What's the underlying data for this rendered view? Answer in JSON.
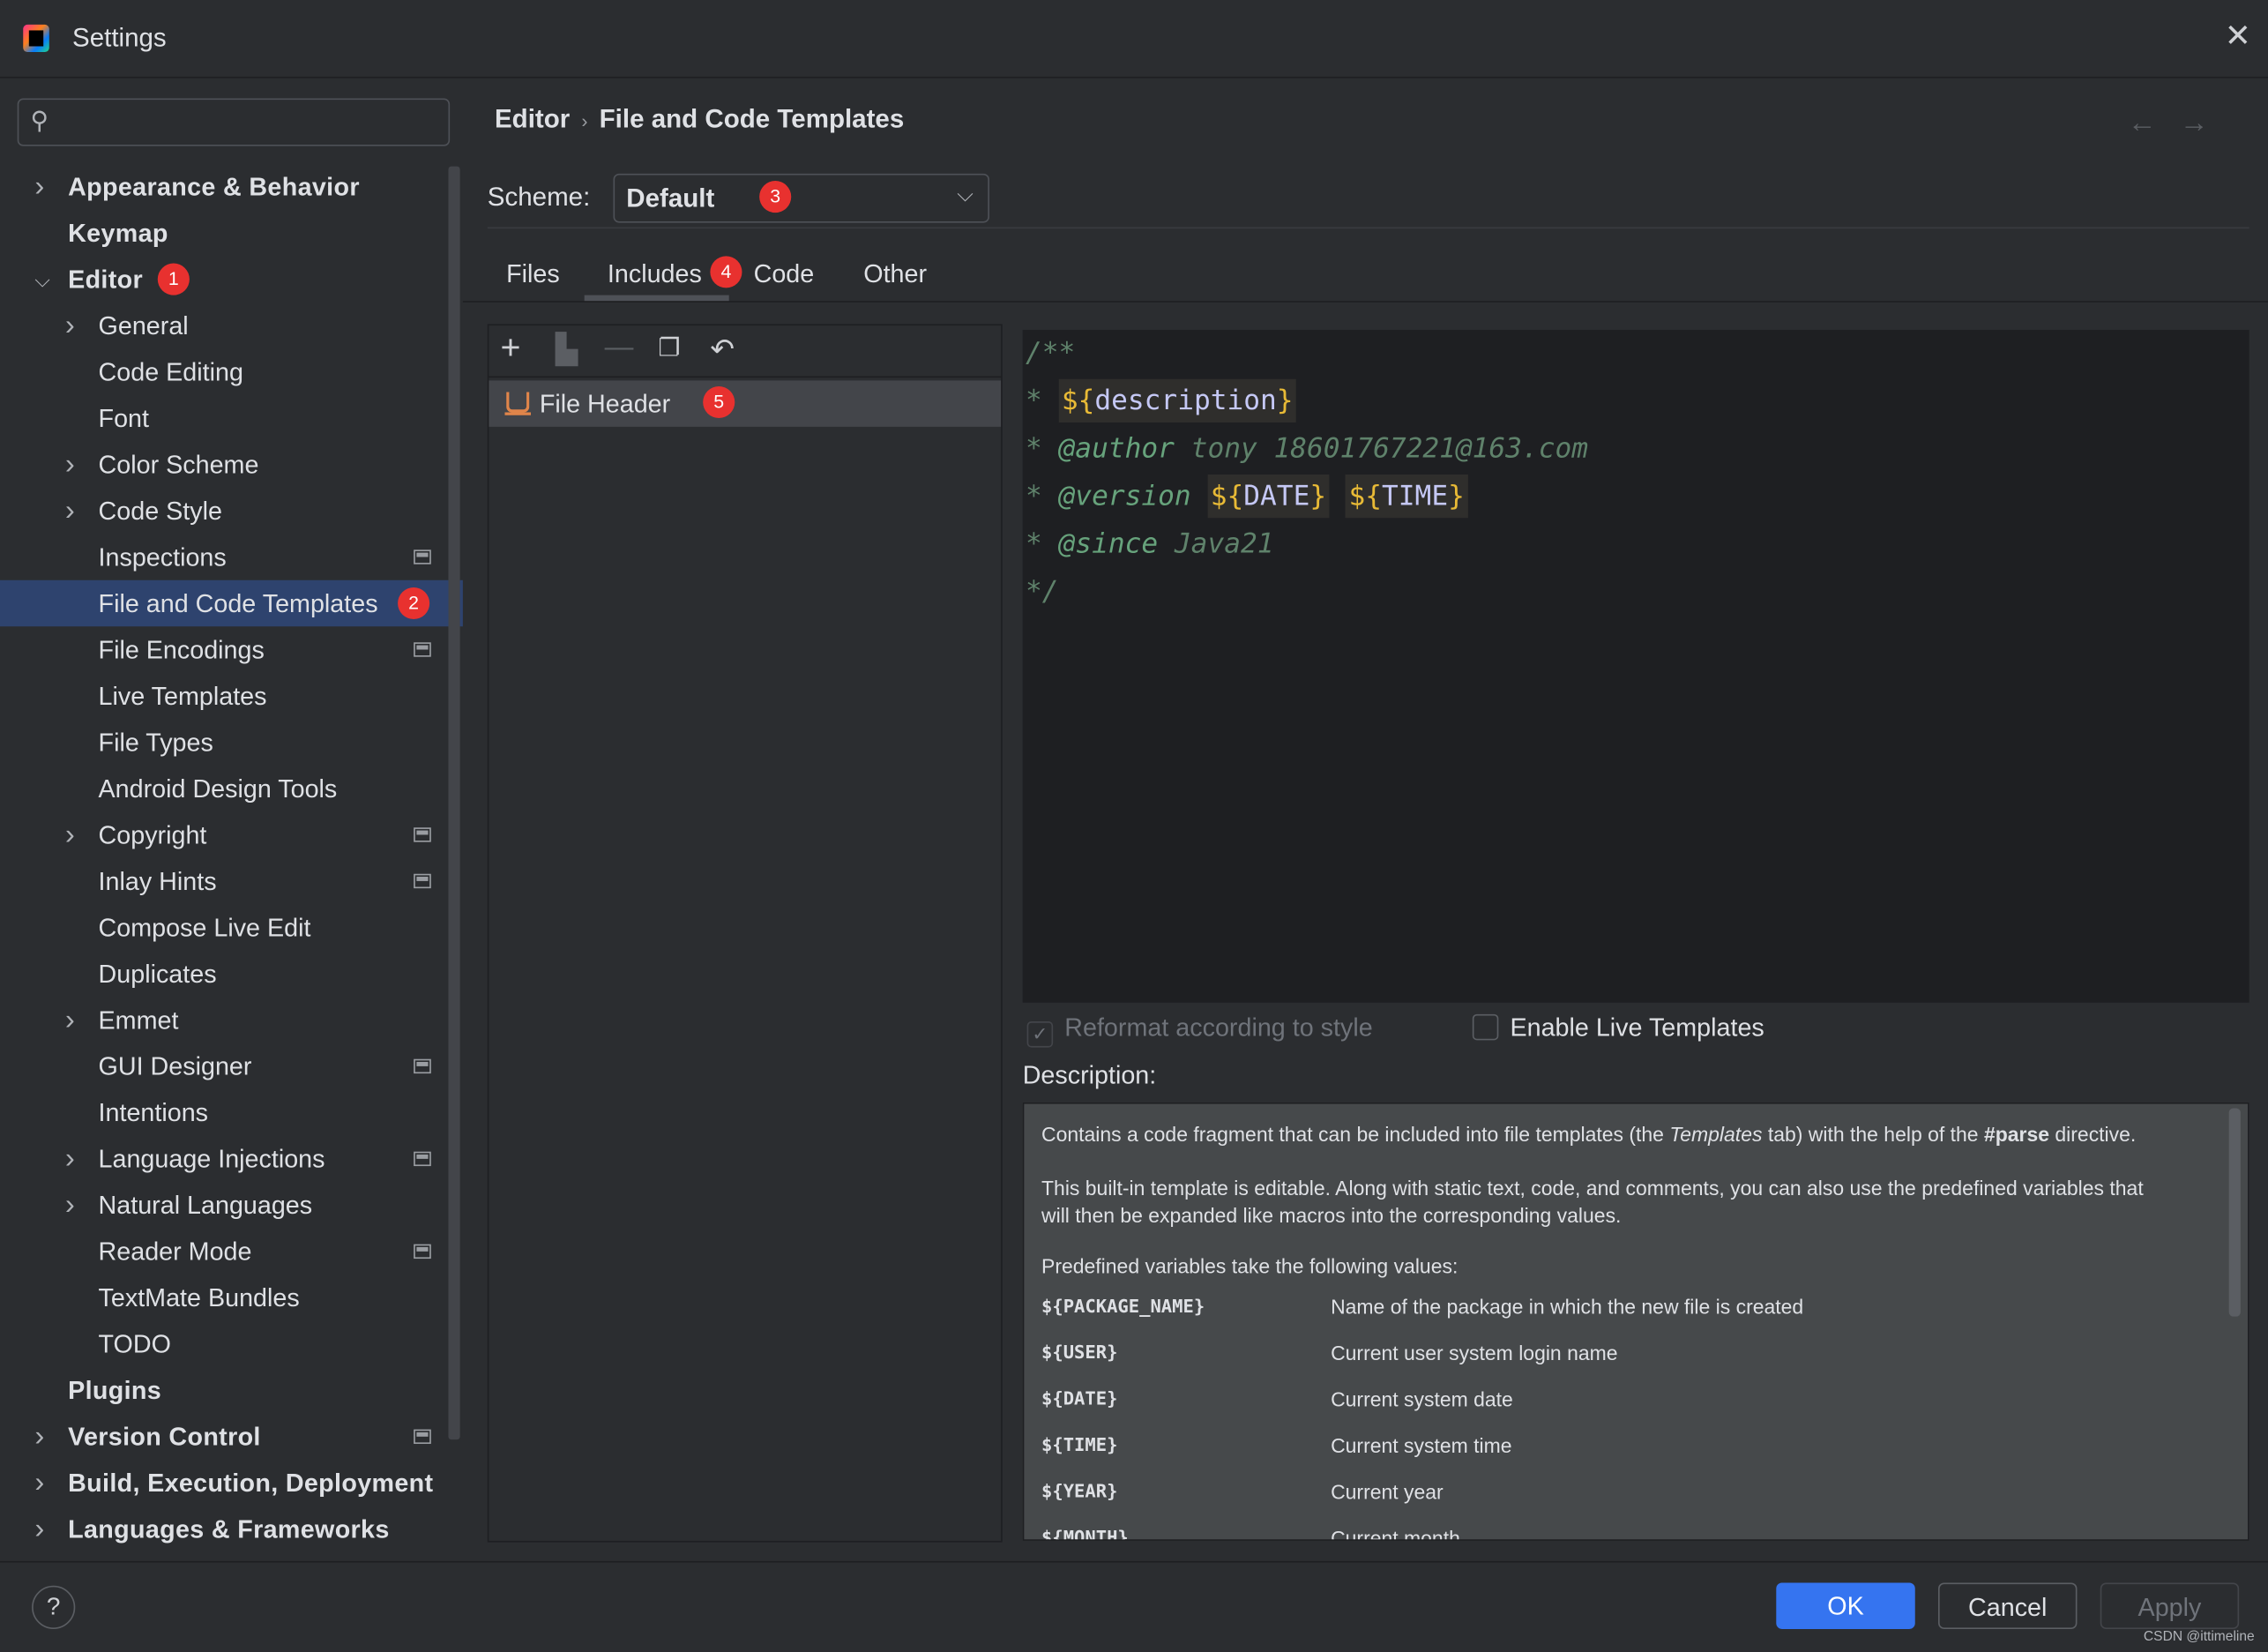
{
  "window": {
    "title": "Settings",
    "close_icon": "close-icon"
  },
  "sidebar": {
    "search_placeholder": "",
    "items": [
      {
        "label": "Appearance & Behavior",
        "level": 0,
        "chevron": "right"
      },
      {
        "label": "Keymap",
        "level": 0
      },
      {
        "label": "Editor",
        "level": 0,
        "chevron": "down",
        "badge": "1"
      },
      {
        "label": "General",
        "level": 1,
        "chevron": "right"
      },
      {
        "label": "Code Editing",
        "level": 1
      },
      {
        "label": "Font",
        "level": 1
      },
      {
        "label": "Color Scheme",
        "level": 1,
        "chevron": "right"
      },
      {
        "label": "Code Style",
        "level": 1,
        "chevron": "right"
      },
      {
        "label": "Inspections",
        "level": 1,
        "project_icon": true
      },
      {
        "label": "File and Code Templates",
        "level": 1,
        "selected": true,
        "badge": "2"
      },
      {
        "label": "File Encodings",
        "level": 1,
        "project_icon": true
      },
      {
        "label": "Live Templates",
        "level": 1
      },
      {
        "label": "File Types",
        "level": 1
      },
      {
        "label": "Android Design Tools",
        "level": 1
      },
      {
        "label": "Copyright",
        "level": 1,
        "chevron": "right",
        "project_icon": true
      },
      {
        "label": "Inlay Hints",
        "level": 1,
        "project_icon": true
      },
      {
        "label": "Compose Live Edit",
        "level": 1
      },
      {
        "label": "Duplicates",
        "level": 1
      },
      {
        "label": "Emmet",
        "level": 1,
        "chevron": "right"
      },
      {
        "label": "GUI Designer",
        "level": 1,
        "project_icon": true
      },
      {
        "label": "Intentions",
        "level": 1
      },
      {
        "label": "Language Injections",
        "level": 1,
        "chevron": "right",
        "project_icon": true
      },
      {
        "label": "Natural Languages",
        "level": 1,
        "chevron": "right"
      },
      {
        "label": "Reader Mode",
        "level": 1,
        "project_icon": true
      },
      {
        "label": "TextMate Bundles",
        "level": 1
      },
      {
        "label": "TODO",
        "level": 1
      },
      {
        "label": "Plugins",
        "level": 0
      },
      {
        "label": "Version Control",
        "level": 0,
        "chevron": "right",
        "project_icon": true
      },
      {
        "label": "Build, Execution, Deployment",
        "level": 0,
        "chevron": "right"
      },
      {
        "label": "Languages & Frameworks",
        "level": 0,
        "chevron": "right"
      }
    ]
  },
  "breadcrumb": {
    "parent": "Editor",
    "current": "File and Code Templates"
  },
  "scheme": {
    "label": "Scheme:",
    "value": "Default",
    "badge": "3"
  },
  "tabs": [
    {
      "label": "Files"
    },
    {
      "label": "Includes",
      "active": true,
      "badge": "4"
    },
    {
      "label": "Code"
    },
    {
      "label": "Other"
    }
  ],
  "templates": {
    "toolbar": [
      "add-icon",
      "add-child-icon",
      "remove-icon",
      "copy-icon",
      "reset-icon"
    ],
    "items": [
      {
        "label": "File Header",
        "badge": "5",
        "icon": "java-cup-icon"
      }
    ]
  },
  "editor": {
    "lines": {
      "open": "/**",
      "star": "*",
      "description_var": "description",
      "author_tag": "@author",
      "author_value": "tony 18601767221@163.com",
      "version_tag": "@version",
      "date_var": "DATE",
      "time_var": "TIME",
      "since_tag": "@since",
      "since_value": "Java21",
      "close": "*/"
    }
  },
  "options": {
    "reformat": {
      "label": "Reformat according to style",
      "checked": true,
      "disabled": true
    },
    "live_templates": {
      "label": "Enable Live Templates",
      "checked": false
    }
  },
  "description": {
    "label": "Description:",
    "para1_a": "Contains a code fragment that can be included into file templates (the ",
    "para1_italic": "Templates",
    "para1_b": " tab) with the help of the ",
    "para1_bold": "#parse",
    "para1_c": " directive.",
    "para2": "This built-in template is editable. Along with static text, code, and comments, you can also use the predefined variables that will then be expanded like macros into the corresponding values.",
    "para3": "Predefined variables take the following values:",
    "variables": [
      {
        "name": "${PACKAGE_NAME}",
        "desc": "Name of the package in which the new file is created"
      },
      {
        "name": "${USER}",
        "desc": "Current user system login name"
      },
      {
        "name": "${DATE}",
        "desc": "Current system date"
      },
      {
        "name": "${TIME}",
        "desc": "Current system time"
      },
      {
        "name": "${YEAR}",
        "desc": "Current year"
      },
      {
        "name": "${MONTH}",
        "desc": "Current month"
      }
    ]
  },
  "footer": {
    "help": "?",
    "ok": "OK",
    "cancel": "Cancel",
    "apply": "Apply",
    "watermark": "CSDN @ittimeline"
  },
  "colors": {
    "accent": "#3574f0",
    "selection": "#2e436e",
    "badge": "#e8312f",
    "comment": "#5f826b",
    "variable_brace": "#e8ba36",
    "variable_name": "#c5c8f5"
  }
}
